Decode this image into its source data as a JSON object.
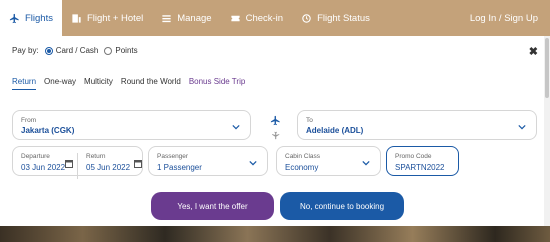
{
  "nav": {
    "tabs": [
      {
        "label": "Flights",
        "icon": "plane-icon"
      },
      {
        "label": "Flight + Hotel",
        "icon": "hotel-icon"
      },
      {
        "label": "Manage",
        "icon": "list-icon"
      },
      {
        "label": "Check-in",
        "icon": "ticket-icon"
      },
      {
        "label": "Flight Status",
        "icon": "location-pin-icon"
      }
    ],
    "login": "Log In / Sign Up"
  },
  "payby": {
    "label": "Pay by:",
    "options": [
      "Card / Cash",
      "Points"
    ],
    "selected": "Card / Cash"
  },
  "close": "✖",
  "trip_types": [
    "Return",
    "One-way",
    "Multicity",
    "Round the World",
    "Bonus Side Trip"
  ],
  "selected_trip": "Return",
  "from": {
    "label": "From",
    "value": "Jakarta (CGK)"
  },
  "to": {
    "label": "To",
    "value": "Adelaide (ADL)"
  },
  "departure": {
    "label": "Departure",
    "value": "03 Jun 2022"
  },
  "return": {
    "label": "Return",
    "value": "05 Jun 2022"
  },
  "passenger": {
    "label": "Passenger",
    "value": "1 Passenger"
  },
  "cabin": {
    "label": "Cabin Class",
    "value": "Economy"
  },
  "promo": {
    "label": "Promo Code",
    "value": "SPARTN2022"
  },
  "buttons": {
    "accept": "Yes, I want the offer",
    "decline": "No, continue to booking"
  },
  "colors": {
    "nav_bg": "#c4a27a",
    "brand_blue": "#1b5aa6",
    "purple": "#6a3b8f"
  }
}
